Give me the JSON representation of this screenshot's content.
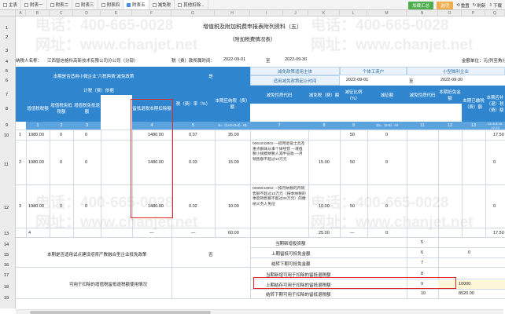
{
  "tabs": [
    {
      "label": "主表",
      "active": false
    },
    {
      "label": "附表一",
      "active": false
    },
    {
      "label": "附表二",
      "active": false
    },
    {
      "label": "附表三",
      "active": false
    },
    {
      "label": "附表四",
      "active": false
    },
    {
      "label": "附表五",
      "active": true
    },
    {
      "label": "减免税",
      "active": false
    },
    {
      "label": "其他扣除...",
      "active": false
    }
  ],
  "tools": {
    "save": "加载汇总",
    "options": "选项",
    "reset": "重置",
    "refresh": "刷新",
    "export": "下载"
  },
  "columns": [
    "A",
    "B",
    "C",
    "D",
    "E",
    "F",
    "G",
    "H",
    "I",
    "J",
    "K",
    "L",
    "M",
    "N",
    "O",
    "P",
    "Q"
  ],
  "rows": [
    "1",
    "2",
    "3",
    "4",
    "5",
    "6",
    "7",
    "8",
    "9",
    "10",
    "11",
    "12",
    "13",
    "14",
    "15",
    "16",
    "17",
    "18",
    "19"
  ],
  "title": "增值税及附加税费申报表附列资料（五）",
  "subtitle": "（附加税费情况表）",
  "info": {
    "taxpayer_label": "纳税人名称：",
    "taxpayer_name": "江西智信格科高新技术有限公司分公司（分部）",
    "period_label": "税（费）款所属时间：",
    "period_start": "2022-09-01",
    "to": "至",
    "period_end": "2022-09-30",
    "unit": "金额单位：元(列至角分)"
  },
  "bands": {
    "small_micro": "本期是否适用小微企业“六税两费”减免政策",
    "yes_no": "是",
    "period": "减免政策适用主体",
    "individual": "个体工商户",
    "small_enterprise": "小型微利企业",
    "applicable_start": "适用减免政策起止时间",
    "start_a": "2022-09-01",
    "end_a": "2022-09-30",
    "start_b": "2022-09-01",
    "end_b": "2022-09-30"
  },
  "headers": {
    "basis": "计税（费）依据",
    "vat_amount": "增值税税额",
    "vat_exempt": "增值税免抵税额",
    "vat_refund": "增值税免抵退额",
    "retained_credit": "留抵退税本期扣除额",
    "rate": "税（费）率（%）",
    "current_payable": "本期应纳税（费）额",
    "reduce_code": "减免性质代码",
    "reduce_amount": "减免税（费）额",
    "small_ratio": "减征比例（%）",
    "small_reduce": "减征额",
    "pilot_code": "减免性质代码",
    "pilot_amount": "本期抵免金额",
    "prepaid": "本期已缴税（费）额",
    "refund_payable": "本期应补（退）税（费）额"
  },
  "colnums": {
    "c1": "1",
    "c2": "2",
    "c3": "3",
    "c4": "4",
    "c5": "5",
    "c6": "6=（1+2+3-4）×5",
    "c7": "7",
    "c8": "8",
    "c9": "9",
    "c10": "10=（6-8）×9",
    "c11": "11",
    "c12": "12",
    "c13": "13",
    "c14": "14=6-8-10-12-13"
  },
  "tax_rows": [
    {
      "no": "1",
      "vat": "1980.00",
      "exempt": "0",
      "refund": "0",
      "credit": "1480.00",
      "rate": "0.07",
      "payable": "35.00",
      "code": "",
      "reduce": "",
      "ratio": "50",
      "small": "0",
      "prepaid": "",
      "due": "17.50"
    },
    {
      "no": "2",
      "vat": "1980.00",
      "exempt": "0",
      "refund": "0",
      "credit": "1480.00",
      "rate": "0.03",
      "payable": "15.00",
      "code": "0061042802\n—招用退役士兵及重点群体从事个体经营\n—增值税小规模纳税人减半征收\n—月销售额不超过10万元",
      "reduce": "15.00",
      "ratio": "50",
      "small": "0",
      "prepaid": "",
      "due": "0"
    },
    {
      "no": "3",
      "vat": "1980.00",
      "exempt": "0",
      "refund": "0",
      "credit": "1480.00",
      "rate": "0.02",
      "payable": "10.00",
      "code": "0099042802\n—按月纳税的月销售额不超过10万元（按季纳税的季度销售额不超过30万元）的缴纳义务人免征",
      "reduce": "10.00",
      "ratio": "50",
      "small": "0",
      "prepaid": "",
      "due": "0"
    },
    {
      "no": "4",
      "vat": "",
      "exempt": "",
      "refund": "",
      "credit": "—",
      "rate": "—",
      "payable": "60.00",
      "code": "",
      "reduce": "25.00",
      "ratio": "—",
      "small": "0",
      "prepaid": "",
      "due": "17.50"
    }
  ],
  "bottom": {
    "label_a": "本期是否适用试点建设培育产教融合型企业抵免政策",
    "label_a_value": "否",
    "label_b": "可用于扣除的增值税留抵退税额使用情况",
    "r1": "当期新增投资额",
    "r1_no": "5",
    "r2": "上期留抵可抵免金额",
    "r2_no": "6",
    "r2_val": "0",
    "r3": "结转下期可抵免金额",
    "r3_no": "7",
    "r4": "当期新增可用于扣除的留抵退税额",
    "r4_no": "8",
    "r5": "上期结存可用于扣除的留抵退税额",
    "r5_no": "9",
    "r5_val": "10000",
    "r6": "结转下期可用于扣除的留抵退税额",
    "r6_no": "10",
    "r6_val": "8520.00"
  },
  "watermarks": [
    "电话：400-665-0028",
    "网址：www.chanjet.net"
  ]
}
